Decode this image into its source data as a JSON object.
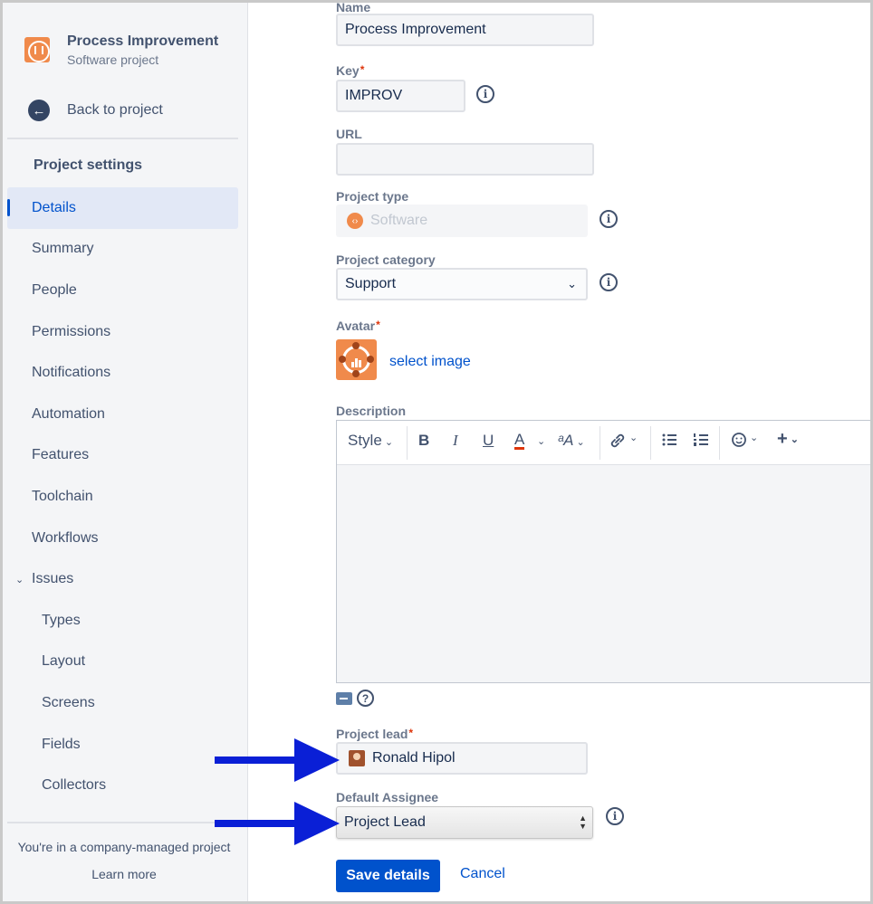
{
  "sidebar": {
    "project_title": "Process Improvement",
    "project_subtitle": "Software project",
    "back_label": "Back to project",
    "section_heading": "Project settings",
    "items": [
      {
        "label": "Details"
      },
      {
        "label": "Summary"
      },
      {
        "label": "People"
      },
      {
        "label": "Permissions"
      },
      {
        "label": "Notifications"
      },
      {
        "label": "Automation"
      },
      {
        "label": "Features"
      },
      {
        "label": "Toolchain"
      },
      {
        "label": "Workflows"
      },
      {
        "label": "Issues"
      },
      {
        "label": "Types"
      },
      {
        "label": "Layout"
      },
      {
        "label": "Screens"
      },
      {
        "label": "Fields"
      },
      {
        "label": "Collectors"
      }
    ],
    "footer_text": "You're in a company-managed project",
    "learn_more": "Learn more"
  },
  "form": {
    "name_label": "Name",
    "name_value": "Process Improvement",
    "key_label": "Key",
    "key_value": "IMPROV",
    "url_label": "URL",
    "url_value": "",
    "type_label": "Project type",
    "type_value": "Software",
    "category_label": "Project category",
    "category_value": "Support",
    "avatar_label": "Avatar",
    "select_image": "select image",
    "description_label": "Description",
    "toolbar": {
      "style": "Style",
      "bold": "B",
      "italic": "I",
      "underline": "U",
      "text_color": "A",
      "more_format": "ᵃA"
    },
    "lead_label": "Project lead",
    "lead_value": "Ronald Hipol",
    "assignee_label": "Default Assignee",
    "assignee_value": "Project Lead",
    "required_mark": "*",
    "save_label": "Save details",
    "cancel_label": "Cancel"
  },
  "colors": {
    "primary": "#0052cc",
    "arrow": "#0a1fd6",
    "project_avatar": "#f08a4b"
  }
}
